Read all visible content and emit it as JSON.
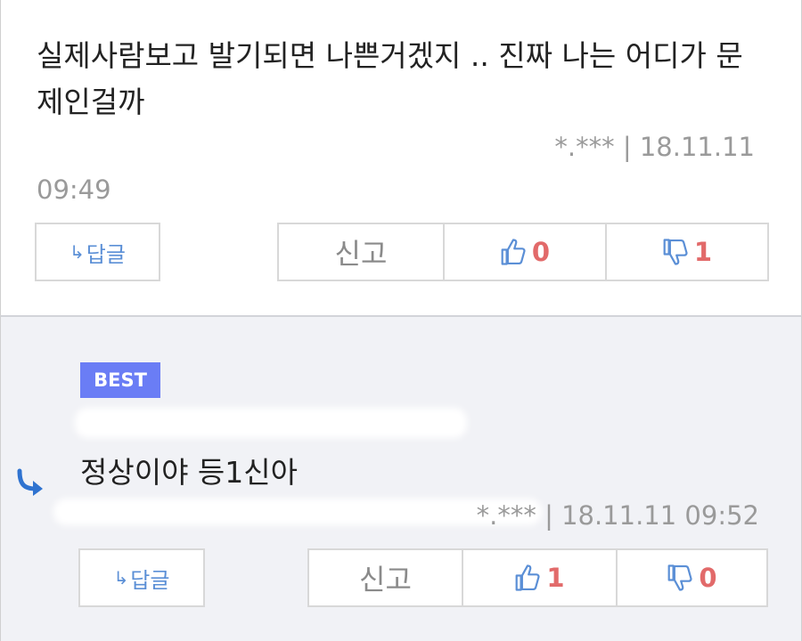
{
  "comments": [
    {
      "text": "실제사람보고 발기되면 나쁜거겠지 .. 진짜 나는 어디가 문제인걸까",
      "author_masked": "*.***",
      "separator": "|",
      "datetime": "18.11.11 09:49",
      "datetime_line1": "18.11.11",
      "datetime_line2": "09:49",
      "reply_label": "답글",
      "report_label": "신고",
      "likes": "0",
      "dislikes": "1"
    },
    {
      "badge": "BEST",
      "text": "정상이야 등1신아",
      "author_masked": "*.***",
      "separator": "|",
      "datetime": "18.11.11 09:52",
      "reply_label": "답글",
      "report_label": "신고",
      "likes": "1",
      "dislikes": "0"
    }
  ],
  "colors": {
    "accent_blue": "#5b8fd6",
    "vote_red": "#e26a6a",
    "best_badge": "#6a7df5",
    "reply_bg": "#f1f2f6"
  },
  "icons": {
    "reply": "reply-arrow-icon",
    "like": "thumbs-up-icon",
    "dislike": "thumbs-down-icon"
  }
}
